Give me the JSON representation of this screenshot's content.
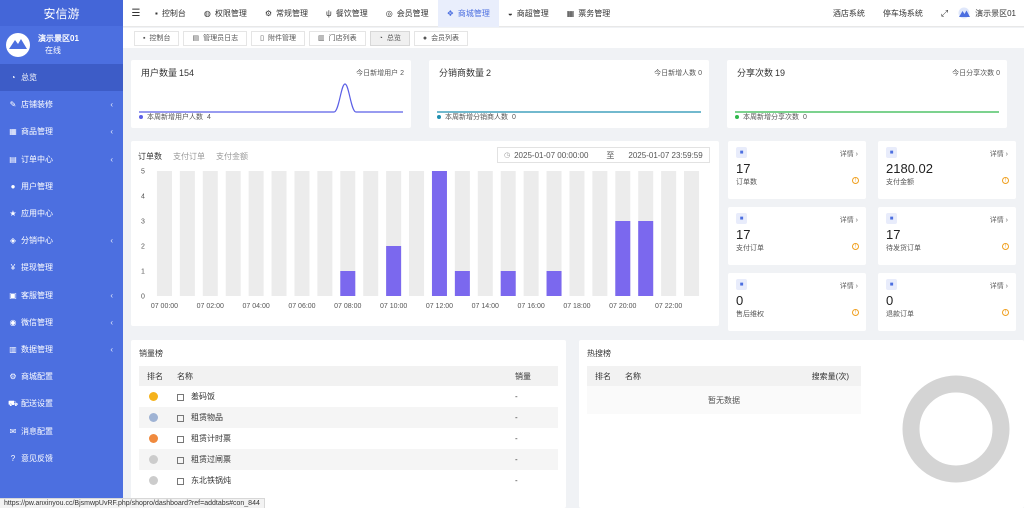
{
  "app": {
    "brand": "安信游",
    "user_name": "演示景区01",
    "user_status": "在线",
    "avatar_text": "安信游"
  },
  "sidebar": {
    "items": [
      {
        "label": "总览",
        "icon": "dashboard-icon",
        "glyph": "◔",
        "active": true,
        "has_children": false
      },
      {
        "label": "店铺装修",
        "icon": "brush-icon",
        "glyph": "✎",
        "active": false,
        "has_children": true
      },
      {
        "label": "商品管理",
        "icon": "box-icon",
        "glyph": "▦",
        "active": false,
        "has_children": true
      },
      {
        "label": "订单中心",
        "icon": "file-icon",
        "glyph": "▤",
        "active": false,
        "has_children": true
      },
      {
        "label": "用户管理",
        "icon": "user-icon",
        "glyph": "●",
        "active": false,
        "has_children": false
      },
      {
        "label": "应用中心",
        "icon": "star-icon",
        "glyph": "★",
        "active": false,
        "has_children": false
      },
      {
        "label": "分销中心",
        "icon": "share-icon",
        "glyph": "◈",
        "active": false,
        "has_children": true
      },
      {
        "label": "提现管理",
        "icon": "yen-icon",
        "glyph": "¥",
        "active": false,
        "has_children": false
      },
      {
        "label": "客服管理",
        "icon": "chat-icon",
        "glyph": "▣",
        "active": false,
        "has_children": true
      },
      {
        "label": "微信管理",
        "icon": "wechat-icon",
        "glyph": "◉",
        "active": false,
        "has_children": true
      },
      {
        "label": "数据管理",
        "icon": "chart-icon",
        "glyph": "▥",
        "active": false,
        "has_children": true
      },
      {
        "label": "商城配置",
        "icon": "gears-icon",
        "glyph": "⚙",
        "active": false,
        "has_children": false
      },
      {
        "label": "配送设置",
        "icon": "truck-icon",
        "glyph": "⛟",
        "active": false,
        "has_children": false
      },
      {
        "label": "消息配置",
        "icon": "bullhorn-icon",
        "glyph": "✉",
        "active": false,
        "has_children": false
      },
      {
        "label": "意见反馈",
        "icon": "question-icon",
        "glyph": "?",
        "active": false,
        "has_children": false
      }
    ]
  },
  "topnav": {
    "items": [
      {
        "label": "控制台",
        "icon": "car-icon",
        "glyph": "▪",
        "active": false
      },
      {
        "label": "权限管理",
        "icon": "users-icon",
        "glyph": "◍",
        "active": false
      },
      {
        "label": "常规管理",
        "icon": "cogs-icon",
        "glyph": "⚙",
        "active": false
      },
      {
        "label": "餐饮管理",
        "icon": "cutlery-icon",
        "glyph": "ψ",
        "active": false
      },
      {
        "label": "会员管理",
        "icon": "member-icon",
        "glyph": "◎",
        "active": false
      },
      {
        "label": "商城管理",
        "icon": "dropbox-icon",
        "glyph": "❖",
        "active": true
      },
      {
        "label": "商超管理",
        "icon": "basket-icon",
        "glyph": "◒",
        "active": false
      },
      {
        "label": "票务管理",
        "icon": "grid-icon",
        "glyph": "▦",
        "active": false
      }
    ],
    "right": {
      "hotel": "酒店系统",
      "parking": "停车场系统",
      "region": "演示景区01"
    }
  },
  "tabs": [
    {
      "label": "控制台",
      "icon": "car-icon",
      "glyph": "▪",
      "active": false
    },
    {
      "label": "管理员日志",
      "icon": "list-icon",
      "glyph": "▤",
      "active": false
    },
    {
      "label": "附件管理",
      "icon": "file-icon",
      "glyph": "▯",
      "active": false
    },
    {
      "label": "门店列表",
      "icon": "bank-icon",
      "glyph": "▥",
      "active": false
    },
    {
      "label": "总览",
      "icon": "dashboard-icon",
      "glyph": "◔",
      "active": true
    },
    {
      "label": "会员列表",
      "icon": "user-icon",
      "glyph": "●",
      "active": false
    }
  ],
  "stats": [
    {
      "title": "用户数量",
      "value": "154",
      "side": "今日新增用户 2",
      "legend": "本周新增用户人数",
      "legend_value": "4",
      "color": "#5b5fe6",
      "spike": true
    },
    {
      "title": "分销商数量",
      "value": "2",
      "side": "今日新增人数 0",
      "legend": "本周新增分销商人数",
      "legend_value": "0",
      "color": "#1f8fb0",
      "spike": false
    },
    {
      "title": "分享次数",
      "value": "19",
      "side": "今日分享次数 0",
      "legend": "本周新增分享次数",
      "legend_value": "0",
      "color": "#2eb84a",
      "spike": false
    }
  ],
  "chart_tabs": [
    "订单数",
    "支付订单",
    "支付金额"
  ],
  "date_range": {
    "start": "2025-01-07 00:00:00",
    "sep": "至",
    "end": "2025-01-07 23:59:59"
  },
  "chart_data": {
    "type": "bar",
    "title": "",
    "xlabel": "",
    "ylabel": "",
    "ylim": [
      0,
      5
    ],
    "yticks": [
      "0",
      "1",
      "2",
      "3",
      "4",
      "5"
    ],
    "categories": [
      "00",
      "01",
      "02",
      "03",
      "04",
      "05",
      "06",
      "07",
      "08",
      "09",
      "10",
      "11",
      "12",
      "13",
      "14",
      "15",
      "16",
      "17",
      "18",
      "19",
      "20",
      "21",
      "22",
      "23"
    ],
    "tick_labels": [
      {
        "index": 0,
        "label": "07 00:00"
      },
      {
        "index": 2,
        "label": "07 02:00"
      },
      {
        "index": 4,
        "label": "07 04:00"
      },
      {
        "index": 6,
        "label": "07 06:00"
      },
      {
        "index": 8,
        "label": "07 08:00"
      },
      {
        "index": 10,
        "label": "07 10:00"
      },
      {
        "index": 12,
        "label": "07 12:00"
      },
      {
        "index": 14,
        "label": "07 14:00"
      },
      {
        "index": 16,
        "label": "07 16:00"
      },
      {
        "index": 18,
        "label": "07 18:00"
      },
      {
        "index": 20,
        "label": "07 20:00"
      },
      {
        "index": 22,
        "label": "07 22:00"
      }
    ],
    "values": [
      0,
      0,
      0,
      0,
      0,
      0,
      0,
      0,
      1,
      0,
      2,
      0,
      5,
      1,
      0,
      1,
      0,
      1,
      0,
      0,
      3,
      3,
      0,
      0
    ],
    "bar_color": "#7b68ee",
    "bg_color": "#ececec"
  },
  "mini_cards": [
    {
      "value": "17",
      "label": "订单数",
      "detail": "详情 ›",
      "icon": "cart-icon"
    },
    {
      "value": "2180.02",
      "label": "支付金额",
      "detail": "详情 ›",
      "icon": "money-icon"
    },
    {
      "value": "17",
      "label": "支付订单",
      "detail": "详情 ›",
      "icon": "check-icon"
    },
    {
      "value": "17",
      "label": "待发货订单",
      "detail": "详情 ›",
      "icon": "truck-icon"
    },
    {
      "value": "0",
      "label": "售后维权",
      "detail": "详情 ›",
      "icon": "shield-icon"
    },
    {
      "value": "0",
      "label": "退款订单",
      "detail": "详情 ›",
      "icon": "refund-icon"
    }
  ],
  "rank": {
    "title": "销量榜",
    "headers": [
      "排名",
      "名称",
      "销量"
    ],
    "rows": [
      {
        "name": "羞码饭",
        "sales": "-",
        "badge_color": "#f5b21b"
      },
      {
        "name": "租赁物品",
        "sales": "-",
        "badge_color": "#9fb3d4"
      },
      {
        "name": "租赁计时票",
        "sales": "-",
        "badge_color": "#f08a3e"
      },
      {
        "name": "租赁过闸票",
        "sales": "-",
        "badge_color": "#cccccc"
      },
      {
        "name": "东北铁锅炖",
        "sales": "-",
        "badge_color": "#cccccc"
      }
    ]
  },
  "hot": {
    "title": "热搜榜",
    "headers": [
      "排名",
      "名称",
      "搜索量(次)"
    ],
    "empty": "暂无数据"
  },
  "statusbar": {
    "url": "https://pw.anxinyou.cc/BjsmwpUvRF.php/shopro/dashboard?ref=addtabs#con_844"
  }
}
